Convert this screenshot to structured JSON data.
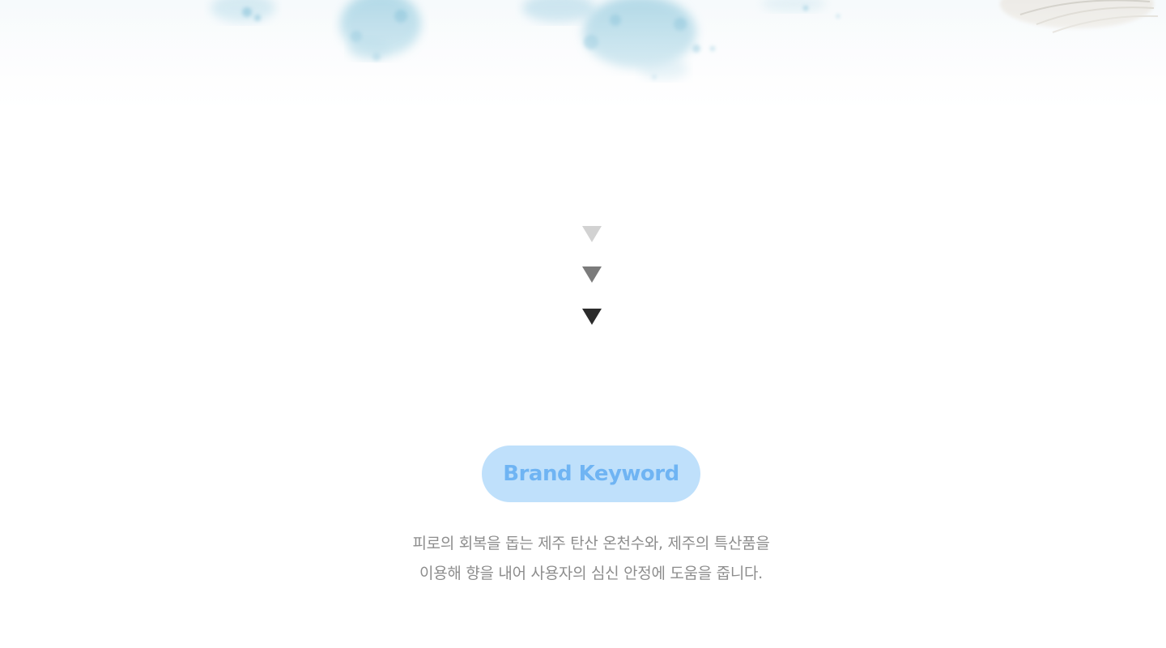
{
  "hero": {
    "image": "watercolor-splash-banner"
  },
  "scroll_indicator": {
    "icons": [
      "arrow-down-icon",
      "arrow-down-icon",
      "arrow-down-icon"
    ],
    "colors": [
      "#d2d2d2",
      "#7b7b7b",
      "#2b2b2b"
    ]
  },
  "keyword": {
    "label": "Brand Keyword",
    "background": "#bfe0fb",
    "text_color": "#6fb4f3"
  },
  "description": {
    "line1": "피로의 회복을 돕는 제주 탄산 온천수와, 제주의 특산품을",
    "line2": "이용해 향을 내어 사용자의 심신 안정에 도움을 줍니다."
  }
}
